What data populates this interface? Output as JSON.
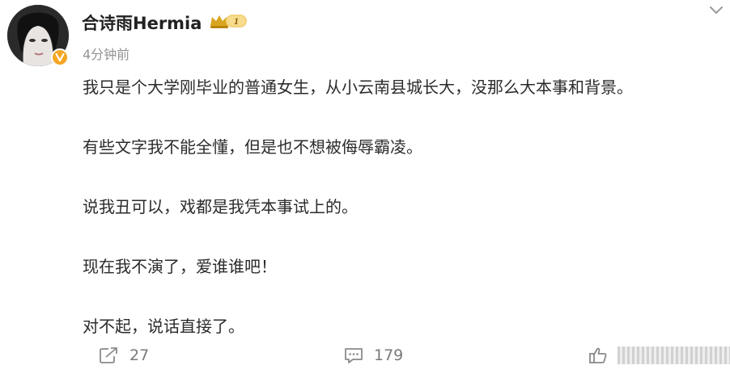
{
  "post": {
    "author": "合诗雨Hermia",
    "vip_level": "1",
    "timestamp": "4分钟前",
    "lines": [
      "我只是个大学刚毕业的普通女生，从小云南县城长大，没那么大本事和背景。",
      "有些文字我不能全懂，但是也不想被侮辱霸凌。",
      "说我丑可以，戏都是我凭本事试上的。",
      "现在我不演了，爱谁谁吧！",
      "对不起，说话直接了。"
    ]
  },
  "actions": {
    "repost_count": "27",
    "comment_count": "179",
    "repost_icon": "share-icon",
    "comment_icon": "comment-icon",
    "like_icon": "thumbs-up-icon"
  },
  "colors": {
    "verified_badge": "#f5a623",
    "vip_gold": "#d9a520",
    "muted_text": "#939393"
  }
}
